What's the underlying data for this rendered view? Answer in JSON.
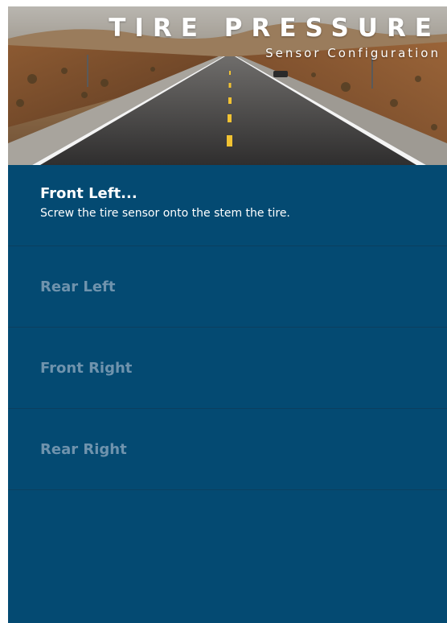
{
  "header": {
    "title": "TIRE PRESSURE",
    "subtitle": "Sensor Configuration"
  },
  "sensors": [
    {
      "label": "Front Left...",
      "instruction": "Screw the tire sensor onto the stem the tire.",
      "active": true
    },
    {
      "label": "Rear Left",
      "active": false
    },
    {
      "label": "Front Right",
      "active": false
    },
    {
      "label": "Rear Right",
      "active": false
    }
  ],
  "colors": {
    "background": "#044a72",
    "active_text": "#ffffff",
    "inactive_text": "#6f93ad"
  }
}
